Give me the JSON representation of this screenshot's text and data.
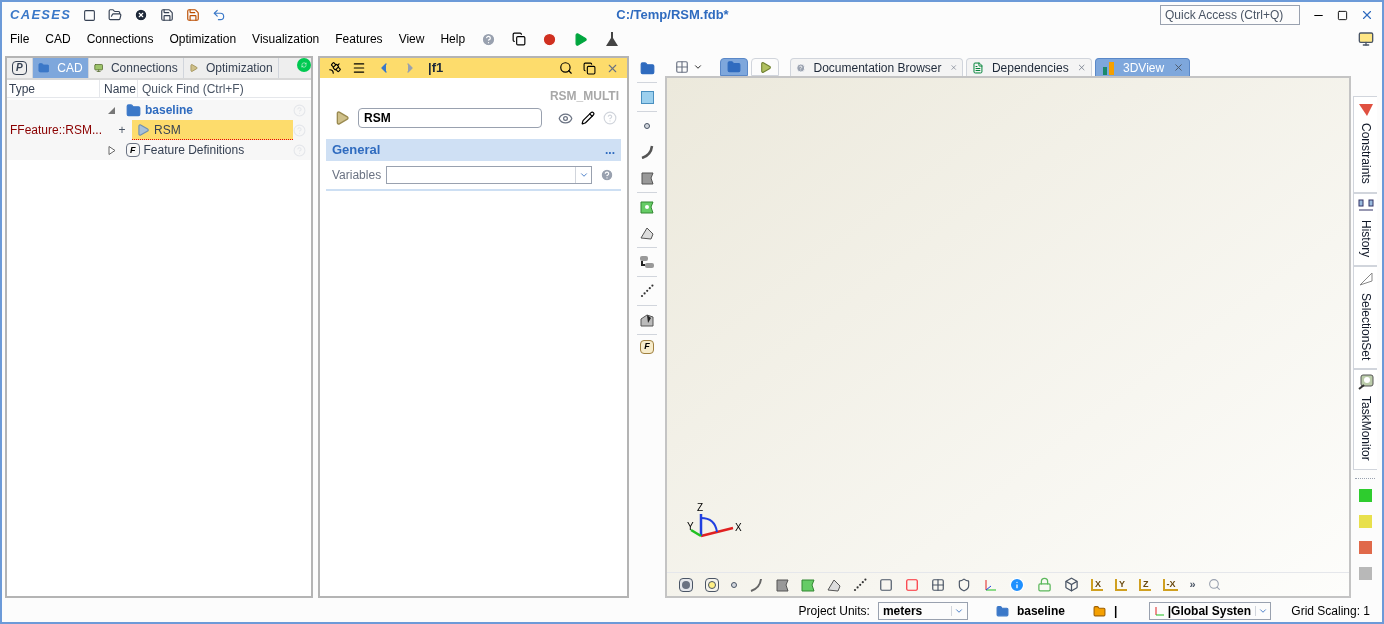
{
  "app": {
    "logo": "CAESES",
    "title": "C:/Temp/RSM.fdb*",
    "quick_access": {
      "placeholder": "Quick Access (Ctrl+Q)"
    }
  },
  "menu": [
    "File",
    "CAD",
    "Connections",
    "Optimization",
    "Visualization",
    "Features",
    "View",
    "Help"
  ],
  "left_panel": {
    "tabs": [
      {
        "label": "P",
        "kind": "letter",
        "selected": false
      },
      {
        "label": "CAD",
        "kind": "folder",
        "selected": true
      },
      {
        "label": "Connections",
        "kind": "monitor",
        "selected": false
      },
      {
        "label": "Optimization",
        "kind": "play",
        "selected": false
      }
    ],
    "columns": [
      "Type",
      "Name"
    ],
    "quick_find": {
      "placeholder": "Quick Find (Ctrl+F)"
    },
    "tree": [
      {
        "name": "baseline",
        "kind": "group",
        "expanded": true,
        "children": [
          {
            "type": "FFeature::RSM...",
            "name": "RSM",
            "kind": "feature",
            "expander": "+",
            "selected": true
          }
        ]
      },
      {
        "name": "Feature Definitions",
        "kind": "definitions",
        "letter": "F",
        "expanded": false
      }
    ]
  },
  "editor": {
    "path": "|f1",
    "type_label": "RSM_MULTI",
    "name_value": "RSM",
    "section": {
      "title": "General",
      "more": "...",
      "expanded": true
    },
    "fields": [
      {
        "label": "Variables"
      }
    ]
  },
  "side_tool_letter": "F",
  "view_tabs": [
    {
      "label": "Documentation Browser",
      "kind": "help",
      "selected": false
    },
    {
      "label": "Dependencies",
      "kind": "deps",
      "selected": false
    },
    {
      "label": "3DView",
      "kind": "chart",
      "selected": true
    }
  ],
  "axes": {
    "x": "X",
    "y": "Y",
    "z": "Z"
  },
  "view_buttons": [
    "X",
    "Y",
    "Z",
    "-X"
  ],
  "overflow": "»",
  "right_tabs": [
    {
      "label": "Constraints",
      "kind": "constraints"
    },
    {
      "label": "History",
      "kind": "history"
    },
    {
      "label": "SelectionSet",
      "kind": "selection"
    },
    {
      "label": "TaskMonitor",
      "kind": "monitor"
    }
  ],
  "swatches": [
    {
      "color": "#2ecc2e"
    },
    {
      "color": "#e8e04c"
    },
    {
      "color": "#e0694a"
    },
    {
      "color": "#b8b8b8"
    }
  ],
  "status": {
    "units_label": "Project Units:",
    "units": "meters",
    "project": "baseline",
    "folder": "|",
    "system": "|Global Systen",
    "grid": "Grid Scaling: 1"
  }
}
